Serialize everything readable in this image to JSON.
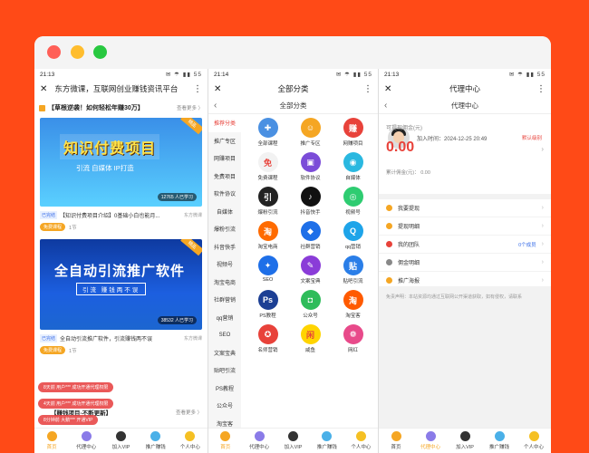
{
  "phone1": {
    "status_time": "21:13",
    "status_icons": "✉ ☂ ▮▮ 55",
    "title": "东方微课，互联网创业赚钱资讯平台",
    "hot_title": "【草根逆袭！如何轻松年赚30万】",
    "hot_more": "查看更多 〉",
    "banner1": {
      "title": "知识付费项目",
      "sub": "引流 自媒体 IP打造",
      "learned": "12765 人已学习",
      "ribbon": "精品"
    },
    "item1": {
      "tag": "已完结",
      "title": "【知识付费项目介绍】0基础小白也能月...",
      "src": "东方微课",
      "pill": "免费课程",
      "count": "1节"
    },
    "banner2": {
      "title": "全自动引流推广软件",
      "sub": "引流 赚钱两不误",
      "learned": "38532 人已学习",
      "ribbon": "精品"
    },
    "item2": {
      "tag": "已完结",
      "title": "全自动引流推广软件，引流赚钱两不误",
      "src": "东方微课",
      "pill": "免费课程",
      "count": "1节"
    },
    "toasts": [
      "8天前 用户*** 成功开通代理权限",
      "4天前 用户*** 成功开通代理权限",
      "8分钟前 大鹅*** 开通VIP"
    ],
    "notice_title": "【赚钱项目-不断更新】",
    "notice_more": "查看更多 〉",
    "tabs": [
      "首页",
      "代理中心",
      "加入VIP",
      "推广赚钱",
      "个人中心"
    ]
  },
  "phone2": {
    "status_time": "21:14",
    "status_icons": "✉ ☂ ▮▮ 55",
    "title": "全部分类",
    "subtitle": "全部分类",
    "categories": [
      "推荐分类",
      "推广专区",
      "网赚项目",
      "免费项目",
      "软件协议",
      "自媒体",
      "爆粉引流",
      "抖音快手",
      "视频号",
      "淘宝电商",
      "社群营销",
      "qq营销",
      "SEO",
      "文案宝典",
      "贴吧引流",
      "PS教程",
      "公众号",
      "淘宝客"
    ],
    "grid": [
      {
        "label": "全部课程",
        "glyph": "✚",
        "color": "#4a90e2"
      },
      {
        "label": "推广专区",
        "glyph": "☺",
        "color": "#f5a623"
      },
      {
        "label": "网赚项目",
        "glyph": "赚",
        "color": "#e8423a"
      },
      {
        "label": "免费课程",
        "glyph": "免",
        "color": "#f2f2f2"
      },
      {
        "label": "软件协议",
        "glyph": "▣",
        "color": "#7b4cd8"
      },
      {
        "label": "自媒体",
        "glyph": "◉",
        "color": "#2ab8e0"
      },
      {
        "label": "爆粉引流",
        "glyph": "引",
        "color": "#222"
      },
      {
        "label": "抖音快手",
        "glyph": "♪",
        "color": "#111"
      },
      {
        "label": "视频号",
        "glyph": "◎",
        "color": "#2ecc71"
      },
      {
        "label": "淘宝电商",
        "glyph": "淘",
        "color": "#ff6b00"
      },
      {
        "label": "社群营销",
        "glyph": "◆",
        "color": "#1e6fe8"
      },
      {
        "label": "qq营销",
        "glyph": "Q",
        "color": "#1ea4e9"
      },
      {
        "label": "SEO",
        "glyph": "✦",
        "color": "#1e6fe8"
      },
      {
        "label": "文案宝典",
        "glyph": "✎",
        "color": "#8a3cd8"
      },
      {
        "label": "贴吧引流",
        "glyph": "贴",
        "color": "#2a7ee8"
      },
      {
        "label": "PS教程",
        "glyph": "Ps",
        "color": "#1c3f94"
      },
      {
        "label": "公众号",
        "glyph": "◘",
        "color": "#2ebc5a"
      },
      {
        "label": "淘宝客",
        "glyph": "淘",
        "color": "#ff5a00"
      },
      {
        "label": "名师营销",
        "glyph": "✪",
        "color": "#e8423a"
      },
      {
        "label": "咸鱼",
        "glyph": "闲",
        "color": "#ffd400"
      },
      {
        "label": "网红",
        "glyph": "❁",
        "color": "#e84a8a"
      }
    ],
    "tabs": [
      "首页",
      "代理中心",
      "加入VIP",
      "推广赚钱",
      "个人中心"
    ]
  },
  "phone3": {
    "status_time": "21:13",
    "status_icons": "✉ ☂ ▮▮ 55",
    "title": "代理中心",
    "subtitle": "代理中心",
    "joined": "加入时间：2024-12-25 20:49",
    "exit": "默认级别",
    "withdraw_label": "可提现佣金(元)",
    "amount": "0.00",
    "total": "累计佣金(元)：  0.00",
    "menu": [
      {
        "label": "我要提现",
        "badge": "",
        "color": "#f5a623"
      },
      {
        "label": "提现明细",
        "badge": "",
        "color": "#f5a623"
      },
      {
        "label": "我的团队",
        "badge": "0个成员",
        "color": "#e8423a"
      },
      {
        "label": "佣金明细",
        "badge": "",
        "color": "#888"
      },
      {
        "label": "推广海报",
        "badge": "",
        "color": "#f5a623"
      }
    ],
    "disclaimer": "免责声明：本站资源均通过互联网公开渠道获取，如有侵权，请联系",
    "tabs": [
      "首页",
      "代理中心",
      "加入VIP",
      "推广赚钱",
      "个人中心"
    ]
  }
}
